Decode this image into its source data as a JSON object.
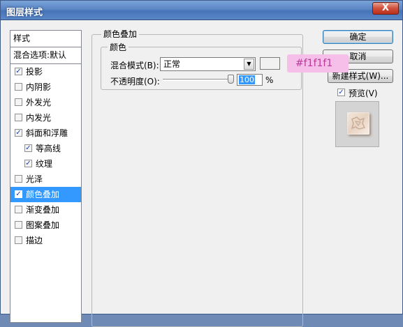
{
  "window": {
    "title": "图层样式",
    "close_label": "X"
  },
  "styles_panel": {
    "header": "样式",
    "blend_options": "混合选项:默认",
    "items": [
      {
        "label": "投影",
        "checked": true,
        "indent": false,
        "selected": false
      },
      {
        "label": "内阴影",
        "checked": false,
        "indent": false,
        "selected": false
      },
      {
        "label": "外发光",
        "checked": false,
        "indent": false,
        "selected": false
      },
      {
        "label": "内发光",
        "checked": false,
        "indent": false,
        "selected": false
      },
      {
        "label": "斜面和浮雕",
        "checked": true,
        "indent": false,
        "selected": false
      },
      {
        "label": "等高线",
        "checked": true,
        "indent": true,
        "selected": false
      },
      {
        "label": "纹理",
        "checked": true,
        "indent": true,
        "selected": false
      },
      {
        "label": "光泽",
        "checked": false,
        "indent": false,
        "selected": false
      },
      {
        "label": "颜色叠加",
        "checked": true,
        "indent": false,
        "selected": true
      },
      {
        "label": "渐变叠加",
        "checked": false,
        "indent": false,
        "selected": false
      },
      {
        "label": "图案叠加",
        "checked": false,
        "indent": false,
        "selected": false
      },
      {
        "label": "描边",
        "checked": false,
        "indent": false,
        "selected": false
      }
    ]
  },
  "color_overlay": {
    "group_title": "颜色叠加",
    "sub_group_title": "颜色",
    "blend_mode_label": "混合模式(B):",
    "blend_mode_value": "正常",
    "swatch_color": "#f1f1f1",
    "annotation": "#f1f1f1",
    "opacity_label": "不透明度(O):",
    "opacity_value": "100",
    "opacity_unit": "%",
    "opacity_fraction": 1.0
  },
  "buttons": {
    "ok": "确定",
    "cancel": "取消",
    "new_style": "新建样式(W)...",
    "preview": "预览(V)",
    "preview_checked": true
  }
}
